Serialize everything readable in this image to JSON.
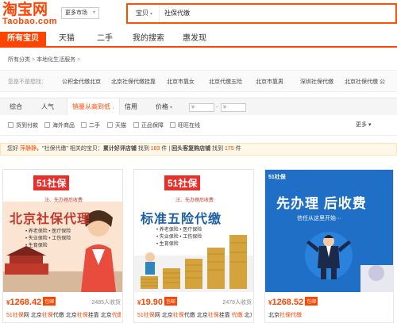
{
  "logo": {
    "cn": "淘宝网",
    "en": "Taobao.com"
  },
  "market": {
    "label": "更多市场"
  },
  "search": {
    "scope": "宝贝",
    "query": "社保代缴"
  },
  "nav": {
    "tabs": [
      "所有宝贝",
      "天猫",
      "二手",
      "我的搜索",
      "惠发现"
    ]
  },
  "breadcrumb": {
    "items": [
      "所有分类",
      "本地化生活服务"
    ]
  },
  "suggest": {
    "label": "您是不是想找：",
    "items": [
      "公积金代缴北京",
      "北京社保代缴挂靠",
      "北京市靠女",
      "北京代缴五险",
      "北京市靠男",
      "深圳社保代缴",
      "北京社保代缴 公"
    ]
  },
  "sort": {
    "items": [
      "综合",
      "人气",
      "销量从高到低",
      "信用",
      "价格"
    ],
    "price_from": "¥",
    "price_to": "¥",
    "dash": "-"
  },
  "filters": {
    "items": [
      "货到付款",
      "海外商品",
      "二手",
      "天猫",
      "正品保障",
      "旺旺在线"
    ],
    "more": "更多"
  },
  "notice": {
    "p1": "您好 ",
    "user": "萍静静",
    "p2": "，\"社保代缴\" 相关的宝贝：",
    "r1_label": "累计好评店铺",
    "r1_mid": " 找到 ",
    "r1_count": "183",
    "r1_unit": " 件",
    "sep": " | ",
    "r2_label": "回头客复购店铺",
    "r2_mid": " 找到 ",
    "r2_count": "175",
    "r2_unit": " 件"
  },
  "products": [
    {
      "img_brand": "51",
      "img_brand2": "社保",
      "img_sub": "汪、先办理后收费",
      "img_headline": "北京社保代理",
      "img_bullets": [
        "• 养老保险 • 医疗保险",
        "• 失业保险 • 工伤保险",
        "• 生育保险"
      ],
      "currency": "¥",
      "price": "1268.42",
      "pay_badge": "包邮",
      "sales": "2485人收货",
      "title_parts": [
        "51",
        "社保",
        "网 北京",
        "社保",
        "代缴 北京",
        "社保",
        "挂靠 北京",
        "代缴",
        " 北京"
      ]
    },
    {
      "img_brand": "51",
      "img_brand2": "社保",
      "img_sub": "汪、先办理后收费",
      "img_headline": "标准五险代缴",
      "img_bullets": [
        "• 养老保险 • 医疗保险",
        "• 失业保险 • 工伤保险",
        "• 生育保险"
      ],
      "currency": "¥",
      "price": "19.90",
      "pay_badge": "包邮",
      "sales": "2478人收货",
      "title_parts": [
        "51",
        "社保",
        "网 北京",
        "社保",
        "代缴 北京",
        "社保",
        "挂靠 ",
        "代缴",
        " 北京"
      ]
    },
    {
      "img_brand": "51社保",
      "img_headline": "先办理 后收费",
      "img_sub": "信任从这里开始···",
      "currency": "¥",
      "price": "1268.52",
      "pay_badge": "包邮",
      "sales": "",
      "title_parts": [
        "北京",
        "社保",
        "代缴",
        ""
      ]
    }
  ],
  "colors": {
    "accent": "#ff4400",
    "nav_bg": "#ff4400",
    "card3_bg": "#1f6fc7",
    "notice_bg": "#fff7e8"
  }
}
